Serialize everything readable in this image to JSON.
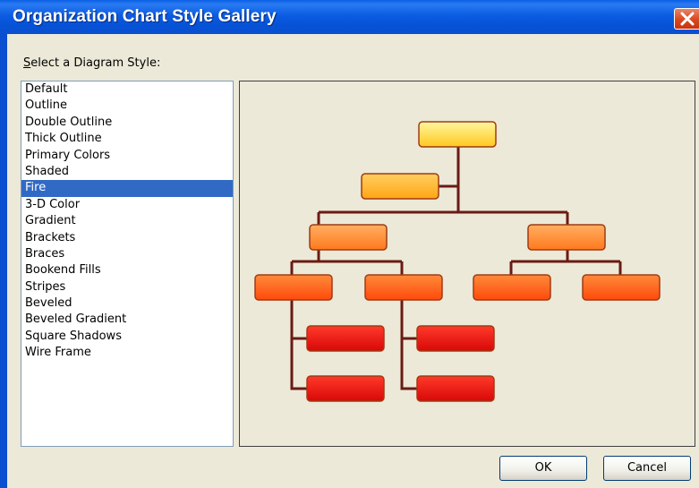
{
  "window": {
    "title": "Organization Chart Style Gallery"
  },
  "prompt": {
    "label": "Select a Diagram Style:"
  },
  "styles": [
    "Default",
    "Outline",
    "Double Outline",
    "Thick Outline",
    "Primary Colors",
    "Shaded",
    "Fire",
    "3-D Color",
    "Gradient",
    "Brackets",
    "Braces",
    "Bookend Fills",
    "Stripes",
    "Beveled",
    "Beveled Gradient",
    "Square Shadows",
    "Wire Frame"
  ],
  "selected_style": "Fire",
  "buttons": {
    "ok": "OK",
    "cancel": "Cancel"
  },
  "colors": {
    "titlebar": "#0a5fe4",
    "selection": "#316ac5",
    "connector": "#6b1a14",
    "level1": "#ffd23a",
    "level2": "#ffb22a",
    "level3": "#ff8a30",
    "level4": "#ff5a1a",
    "level5": "#e40c0c"
  }
}
